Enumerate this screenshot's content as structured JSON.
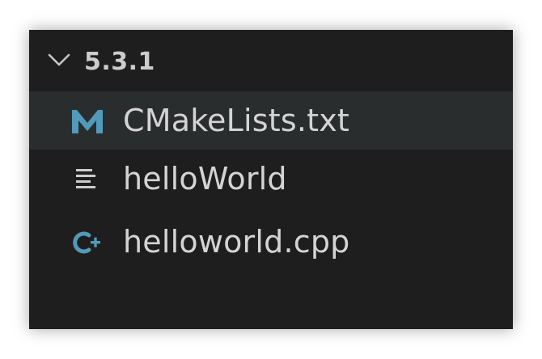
{
  "explorer": {
    "folder": {
      "label": "5.3.1",
      "icon": "chevron-down-icon",
      "expanded": true
    },
    "files": [
      {
        "label": "CMakeLists.txt",
        "icon": "cmake-m-icon",
        "icon_color": "#519aba",
        "selected": true
      },
      {
        "label": "helloWorld",
        "icon": "plain-text-lines-icon",
        "icon_color": "#cccccc",
        "selected": false
      },
      {
        "label": "helloworld.cpp",
        "icon": "cpp-icon",
        "icon_color": "#519aba",
        "selected": false
      }
    ]
  },
  "colors": {
    "panel_bg": "#1e1e1e",
    "selected_bg": "#2a2d2e",
    "text": "#d4d4d4",
    "accent": "#519aba"
  }
}
